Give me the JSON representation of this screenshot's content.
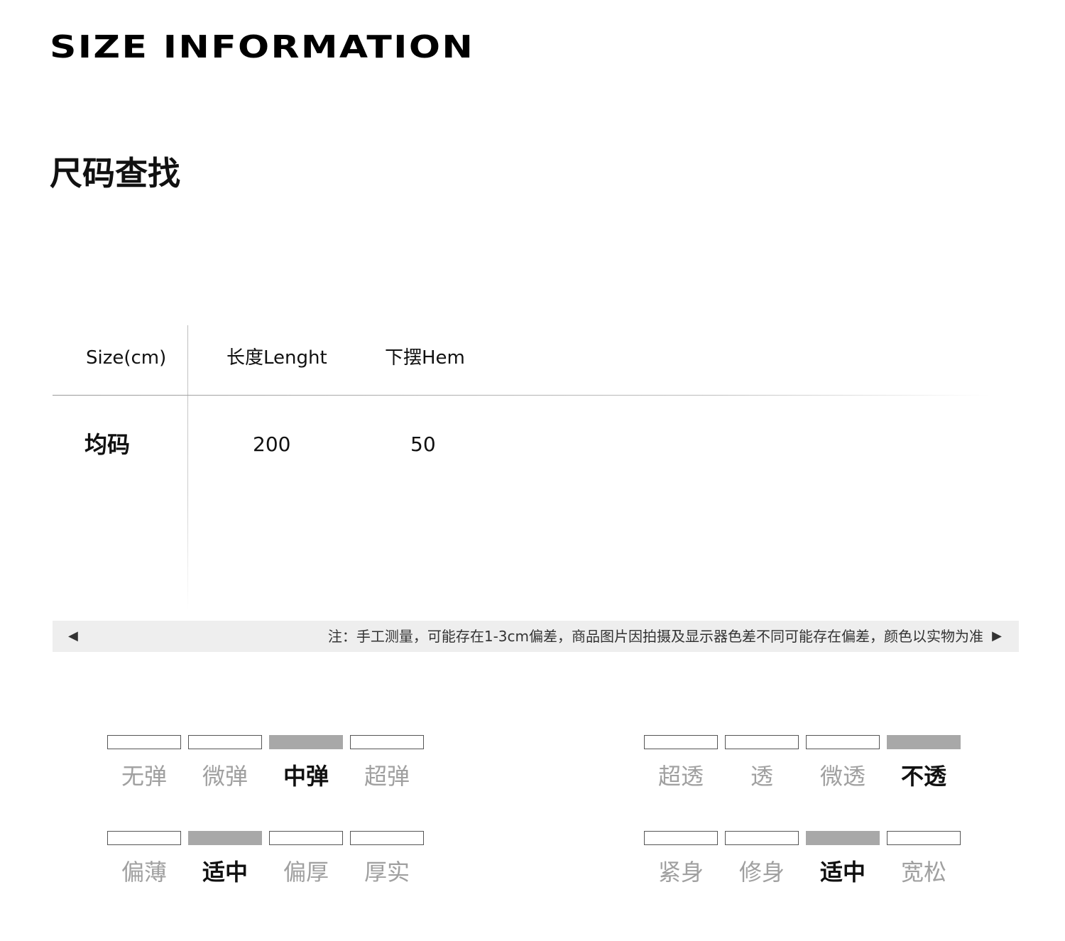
{
  "header": {
    "title": "SIZE INFORMATION",
    "section_title": "尺码查找"
  },
  "size_table": {
    "columns": [
      "Size(cm)",
      "长度Lenght",
      "下摆Hem"
    ],
    "rows": [
      {
        "size": "均码",
        "length": "200",
        "hem": "50"
      }
    ]
  },
  "note": {
    "text": "注：手工测量，可能存在1-3cm偏差，商品图片因拍摄及显示器色差不同可能存在偏差，颜色以实物为准",
    "left_arrow": "◀",
    "right_arrow": "▶"
  },
  "scales": [
    {
      "name": "elasticity",
      "options": [
        "无弹",
        "微弹",
        "中弹",
        "超弹"
      ],
      "selected_index": 2
    },
    {
      "name": "transparency",
      "options": [
        "超透",
        "透",
        "微透",
        "不透"
      ],
      "selected_index": 3
    },
    {
      "name": "thickness",
      "options": [
        "偏薄",
        "适中",
        "偏厚",
        "厚实"
      ],
      "selected_index": 1
    },
    {
      "name": "fit",
      "options": [
        "紧身",
        "修身",
        "适中",
        "宽松"
      ],
      "selected_index": 2
    }
  ],
  "colors": {
    "selected_bar": "#a8a8a8",
    "selected_text": "#111111",
    "unselected_text": "#a0a0a0"
  }
}
